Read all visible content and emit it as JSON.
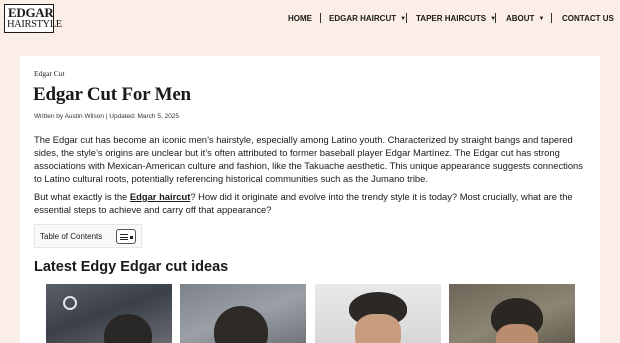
{
  "header": {
    "logo_top": "EDGAR",
    "logo_bottom": "HAIRSTYLE",
    "nav": [
      {
        "label": "HOME",
        "has_dropdown": false
      },
      {
        "label": "EDGAR HAIRCUT",
        "has_dropdown": true
      },
      {
        "label": "TAPER HAIRCUTS",
        "has_dropdown": true
      },
      {
        "label": "ABOUT",
        "has_dropdown": true
      },
      {
        "label": "CONTACT US",
        "has_dropdown": false
      }
    ]
  },
  "article": {
    "breadcrumb": "Edgar Cut",
    "title": "Edgar Cut For Men",
    "meta": {
      "author_prefix": "Written by",
      "author": "Austin Wilson",
      "updated": "Updated: March 5, 2025"
    },
    "para1": "The Edgar cut has become an iconic men’s hairstyle, especially among Latino youth. Characterized by straight bangs and tapered sides, the style’s origins are unclear but it’s often attributed to former baseball player Edgar Martínez. The Edgar cut has strong associations with Mexican-American culture and fashion, like the Takuache aesthetic. This unique appearance suggests connections to Latino cultural roots, potentially referencing historical communities such as the Jumano tribe.",
    "para2_before": "But what exactly is the ",
    "para2_link": "Edgar haircut",
    "para2_after": "? How did it originate and evolve into the trendy style it is today? Most crucially, what are the essential steps to achieve and carry off that appearance?",
    "toc_label": "Table of Contents",
    "section_heading": "Latest Edgy Edgar cut ideas"
  },
  "icons": {
    "caret": "caret-down-icon",
    "toc_toggle": "list-toggle-icon"
  },
  "colors": {
    "page_bg": "#fbeee6",
    "card_bg": "#ffffff",
    "text": "#1a1a1a"
  }
}
